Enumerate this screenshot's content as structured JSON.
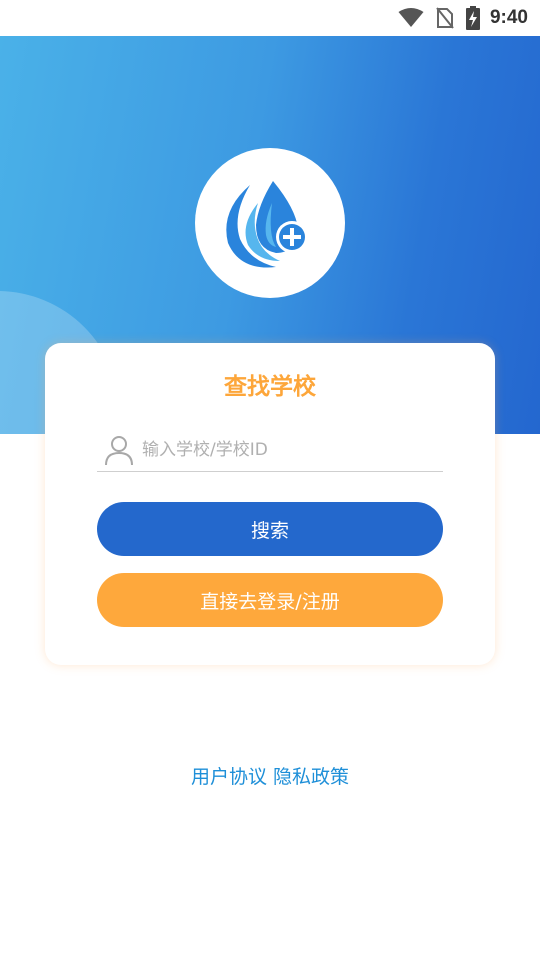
{
  "status_bar": {
    "time": "9:40",
    "icons": [
      "wifi-icon",
      "no-sim-icon",
      "battery-charging-icon"
    ]
  },
  "logo": {
    "icon": "water-drop-plus-icon",
    "colors": {
      "primary": "#2a84dc",
      "light": "#56b6ee"
    }
  },
  "card": {
    "title": "查找学校",
    "search_input": {
      "placeholder": "输入学校/学校ID",
      "value": "",
      "icon": "user-icon"
    },
    "search_button": "搜索",
    "login_button": "直接去登录/注册"
  },
  "footer": {
    "user_agreement": "用户协议",
    "privacy_policy": "隐私政策"
  },
  "colors": {
    "accent_orange": "#fea83c",
    "primary_blue": "#2468cc",
    "link_blue": "#1e8fd8"
  }
}
